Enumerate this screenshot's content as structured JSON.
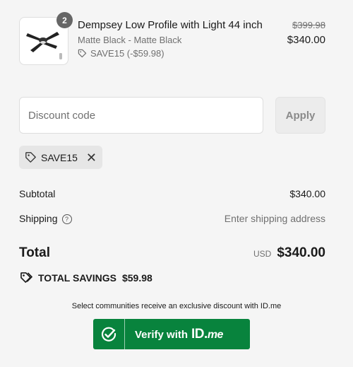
{
  "product": {
    "quantity": "2",
    "name": "Dempsey Low Profile with Light 44 inch",
    "variant": "Matte Black - Matte Black",
    "discount": "SAVE15 (-$59.98)",
    "original_price": "$399.98",
    "price": "$340.00",
    "image_icon": "ceiling-fan-icon"
  },
  "discount": {
    "placeholder": "Discount code",
    "apply_label": "Apply",
    "applied_code": "SAVE15"
  },
  "summary": {
    "subtotal_label": "Subtotal",
    "subtotal_value": "$340.00",
    "shipping_label": "Shipping",
    "shipping_value": "Enter shipping address",
    "total_label": "Total",
    "currency": "USD",
    "total_value": "$340.00",
    "savings_label": "TOTAL SAVINGS",
    "savings_value": "$59.98"
  },
  "idme": {
    "note": "Select communities receive an exclusive discount with ID.me",
    "verify_label": "Verify with",
    "brand_id": "ID.",
    "brand_me": "me",
    "button_color": "#08833d"
  }
}
